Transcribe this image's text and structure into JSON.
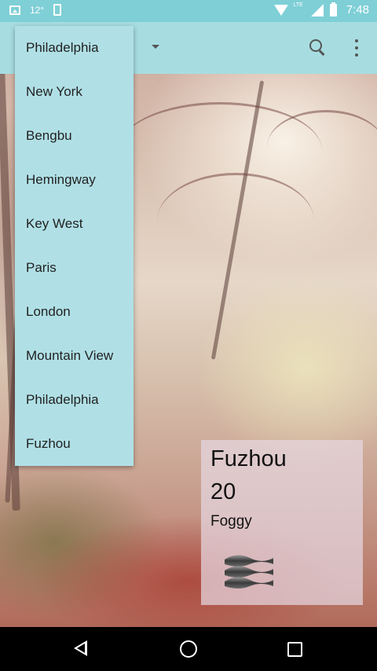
{
  "status_bar": {
    "temperature": "12°",
    "network": "LTE",
    "time": "7:48",
    "icons": [
      "image-icon",
      "notification-icon",
      "wifi-icon",
      "signal-icon",
      "battery-icon"
    ]
  },
  "toolbar": {
    "accent_color": "#a7dde1",
    "icons": [
      "dropdown-arrow-icon",
      "search-icon",
      "overflow-menu-icon"
    ]
  },
  "city_dropdown": {
    "items": [
      {
        "label": "Philadelphia"
      },
      {
        "label": "New York"
      },
      {
        "label": "Bengbu"
      },
      {
        "label": "Hemingway"
      },
      {
        "label": "Key West"
      },
      {
        "label": "Paris"
      },
      {
        "label": "London"
      },
      {
        "label": "Mountain View"
      },
      {
        "label": "Philadelphia"
      },
      {
        "label": "Fuzhou"
      }
    ]
  },
  "weather": {
    "city": "Fuzhou",
    "temperature": "20",
    "condition": "Foggy",
    "icon": "fog-icon"
  },
  "nav_bar": {
    "icons": [
      "back-icon",
      "home-icon",
      "recents-icon"
    ]
  }
}
